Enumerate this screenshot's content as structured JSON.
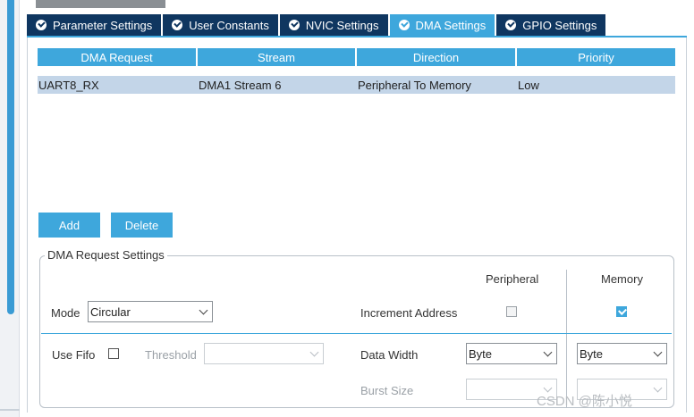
{
  "tabs": [
    {
      "label": "Parameter Settings",
      "active": false
    },
    {
      "label": "User Constants",
      "active": false
    },
    {
      "label": "NVIC Settings",
      "active": false
    },
    {
      "label": "DMA Settings",
      "active": true
    },
    {
      "label": "GPIO Settings",
      "active": false
    }
  ],
  "table": {
    "headers": [
      "DMA Request",
      "Stream",
      "Direction",
      "Priority"
    ],
    "rows": [
      [
        "UART8_RX",
        "DMA1 Stream 6",
        "Peripheral To Memory",
        "Low"
      ]
    ]
  },
  "buttons": {
    "add": "Add",
    "delete": "Delete"
  },
  "settings": {
    "legend": "DMA Request Settings",
    "peripheral_header": "Peripheral",
    "memory_header": "Memory",
    "mode_label": "Mode",
    "mode_value": "Circular",
    "increment_label": "Increment Address",
    "increment_peripheral_checked": false,
    "increment_memory_checked": true,
    "use_fifo_label": "Use Fifo",
    "use_fifo_checked": false,
    "threshold_label": "Threshold",
    "threshold_value": "",
    "data_width_label": "Data Width",
    "data_width_peripheral": "Byte",
    "data_width_memory": "Byte",
    "burst_size_label": "Burst Size",
    "burst_size_peripheral": "",
    "burst_size_memory": ""
  },
  "watermark": "CSDN @陈小悦",
  "colors": {
    "tab_dark": "#0f3660",
    "accent": "#3ea7dc",
    "row_selected": "#c3d5e8"
  }
}
